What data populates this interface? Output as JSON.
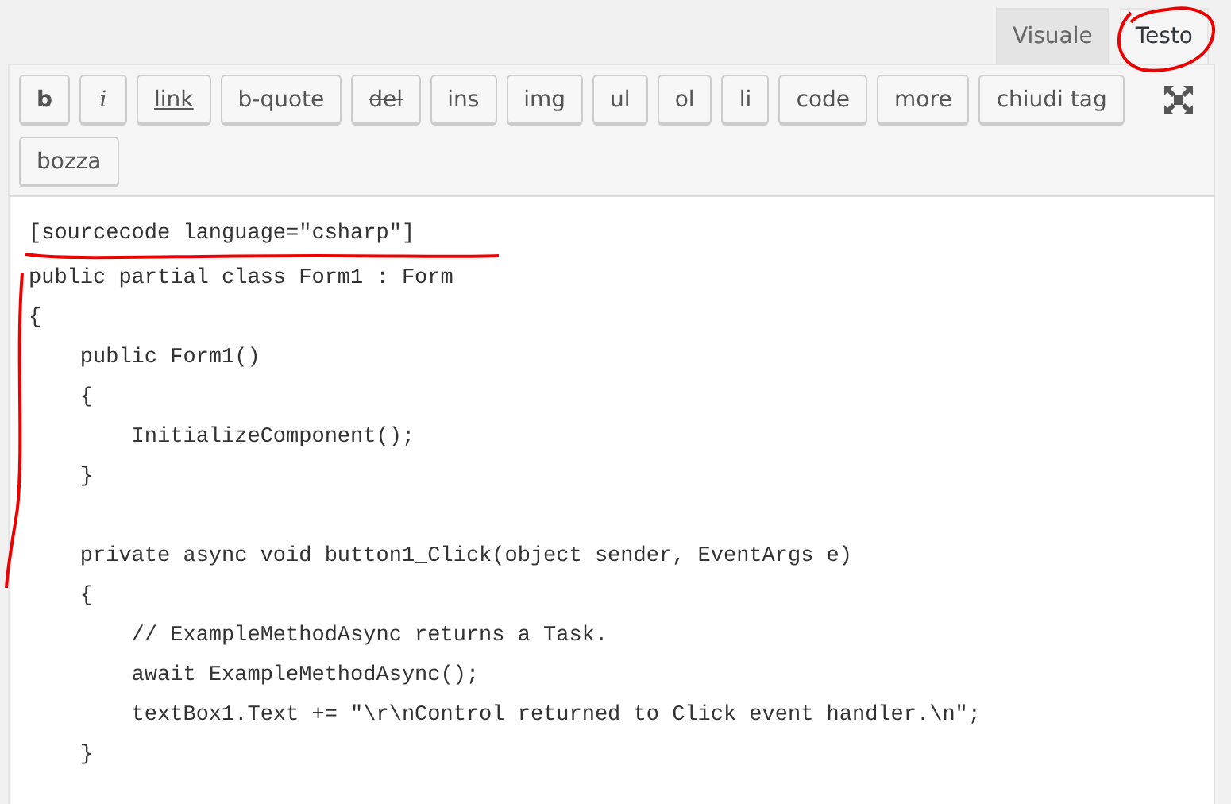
{
  "tabs": [
    {
      "label": "Visuale",
      "selected": false
    },
    {
      "label": "Testo",
      "selected": true
    }
  ],
  "toolbar": {
    "buttons": [
      {
        "label": "b",
        "kind": "bold"
      },
      {
        "label": "i",
        "kind": "italic"
      },
      {
        "label": "link",
        "kind": "underline"
      },
      {
        "label": "b-quote",
        "kind": "plain"
      },
      {
        "label": "del",
        "kind": "strike"
      },
      {
        "label": "ins",
        "kind": "plain"
      },
      {
        "label": "img",
        "kind": "plain"
      },
      {
        "label": "ul",
        "kind": "plain"
      },
      {
        "label": "ol",
        "kind": "plain"
      },
      {
        "label": "li",
        "kind": "plain"
      },
      {
        "label": "code",
        "kind": "plain"
      },
      {
        "label": "more",
        "kind": "plain"
      },
      {
        "label": "chiudi tag",
        "kind": "plain"
      },
      {
        "label": "bozza",
        "kind": "plain"
      }
    ]
  },
  "editor": {
    "shortcode": "[sourcecode language=\"csharp\"]",
    "content": "public partial class Form1 : Form\n{\n    public Form1()\n    {\n        InitializeComponent();\n    }\n\n    private async void button1_Click(object sender, EventArgs e)\n    {\n        // ExampleMethodAsync returns a Task.\n        await ExampleMethodAsync();\n        textBox1.Text += \"\\r\\nControl returned to Click event handler.\\n\";\n    }"
  }
}
